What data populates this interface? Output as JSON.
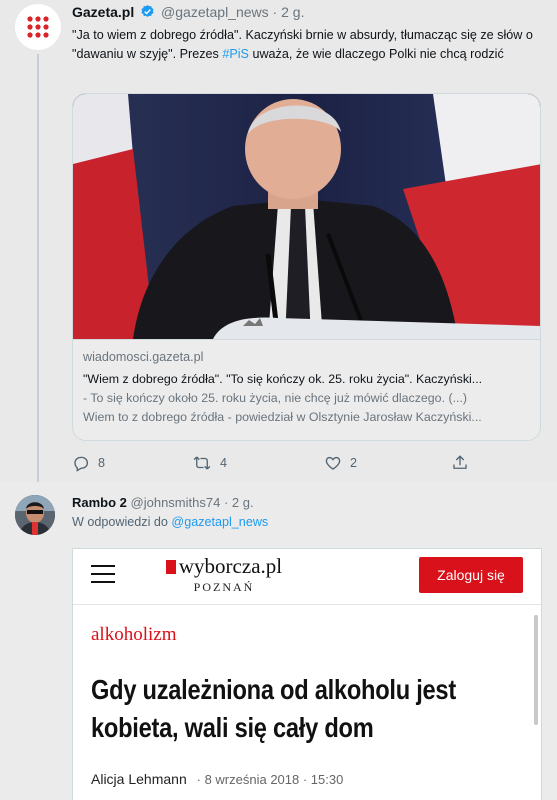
{
  "tweet1": {
    "author_name": "Gazeta.pl",
    "handle": "@gazetapl_news",
    "time": "2 g.",
    "text_part1": "\"Ja to wiem z dobrego źródła\". Kaczyński brnie w absurdy, tłumacząc się ze słów o \"dawaniu w szyję\". Prezes ",
    "hashtag": "#PiS",
    "text_part2": " uważa, że wie dlaczego Polki nie chcą rodzić",
    "card": {
      "domain": "wiadomosci.gazeta.pl",
      "title": "\"Wiem z dobrego źródła\". \"To się kończy ok. 25. roku życia\". Kaczyński...",
      "desc_line1": "- To się kończy około 25. roku życia, nie chcę już mówić dlaczego. (...)",
      "desc_line2": "Wiem to z dobrego źródła - powiedział w Olsztynie Jarosław Kaczyński..."
    },
    "actions": {
      "replies": "8",
      "retweets": "4",
      "likes": "2"
    }
  },
  "tweet2": {
    "author_name": "Rambo 2",
    "handle": "@johnsmiths74",
    "time": "2 g.",
    "reply_prefix": "W odpowiedzi do",
    "reply_to": "@gazetapl_news",
    "embed": {
      "logo": "wyborcza.pl",
      "logo_sub": "POZNAŃ",
      "login_label": "Zaloguj się",
      "category": "alkoholizm",
      "headline": "Gdy uzależniona od alkoholu jest kobieta, wali się cały dom",
      "author": "Alicja Lehmann",
      "date": "· 8 września 2018 · 15:30"
    }
  },
  "colors": {
    "accent_blue": "#1d9bf0",
    "wyborcza_red": "#d9111a"
  },
  "icons": [
    "gazeta-logo-icon",
    "verified-badge-icon",
    "reply-icon",
    "retweet-icon",
    "like-icon",
    "share-icon",
    "hamburger-menu-icon"
  ]
}
